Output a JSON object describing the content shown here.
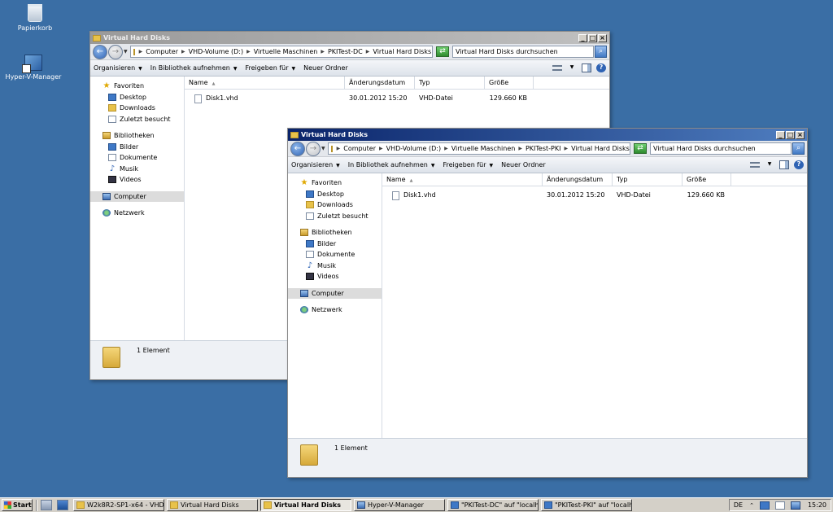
{
  "desktop": {
    "icons": [
      {
        "label": "Papierkorb",
        "icon": "recycle-bin-icon"
      },
      {
        "label": "Hyper-V-Manager",
        "icon": "hyper-v-manager-icon"
      }
    ]
  },
  "window_back": {
    "title": "Virtual Hard Disks",
    "breadcrumbs": [
      "Computer",
      "VHD-Volume (D:)",
      "Virtuelle Maschinen",
      "PKITest-DC",
      "Virtual Hard Disks"
    ],
    "search_placeholder": "Virtual Hard Disks durchsuchen",
    "commands": [
      "Organisieren",
      "In Bibliothek aufnehmen",
      "Freigeben für",
      "Neuer Ordner"
    ],
    "nav": {
      "favorites": "Favoriten",
      "fav_items": [
        "Desktop",
        "Downloads",
        "Zuletzt besucht"
      ],
      "libraries": "Bibliotheken",
      "lib_items": [
        "Bilder",
        "Dokumente",
        "Musik",
        "Videos"
      ],
      "computer": "Computer",
      "network": "Netzwerk"
    },
    "columns": [
      "Name",
      "Änderungsdatum",
      "Typ",
      "Größe"
    ],
    "files": [
      {
        "name": "Disk1.vhd",
        "date": "30.01.2012 15:20",
        "type": "VHD-Datei",
        "size": "129.660 KB"
      }
    ],
    "status": "1 Element"
  },
  "window_front": {
    "title": "Virtual Hard Disks",
    "breadcrumbs": [
      "Computer",
      "VHD-Volume (D:)",
      "Virtuelle Maschinen",
      "PKITest-PKI",
      "Virtual Hard Disks"
    ],
    "search_placeholder": "Virtual Hard Disks durchsuchen",
    "commands": [
      "Organisieren",
      "In Bibliothek aufnehmen",
      "Freigeben für",
      "Neuer Ordner"
    ],
    "nav": {
      "favorites": "Favoriten",
      "fav_items": [
        "Desktop",
        "Downloads",
        "Zuletzt besucht"
      ],
      "libraries": "Bibliotheken",
      "lib_items": [
        "Bilder",
        "Dokumente",
        "Musik",
        "Videos"
      ],
      "computer": "Computer",
      "network": "Netzwerk"
    },
    "columns": [
      "Name",
      "Änderungsdatum",
      "Typ",
      "Größe"
    ],
    "files": [
      {
        "name": "Disk1.vhd",
        "date": "30.01.2012 15:20",
        "type": "VHD-Datei",
        "size": "129.660 KB"
      }
    ],
    "status": "1 Element"
  },
  "taskbar": {
    "start": "Start",
    "buttons": [
      {
        "label": "W2k8R2-SP1-x64 - VHD-...",
        "pressed": false
      },
      {
        "label": "Virtual Hard Disks",
        "pressed": false
      },
      {
        "label": "Virtual Hard Disks",
        "pressed": true
      },
      {
        "label": "Hyper-V-Manager",
        "pressed": false
      },
      {
        "label": "\"PKITest-DC\" auf \"localh...",
        "pressed": false
      },
      {
        "label": "\"PKITest-PKI\" auf \"localho...",
        "pressed": false
      }
    ],
    "language": "DE",
    "clock": "15:20"
  },
  "colors": {
    "desktop": "#3a6ea5",
    "active_title": "#0a246a"
  }
}
